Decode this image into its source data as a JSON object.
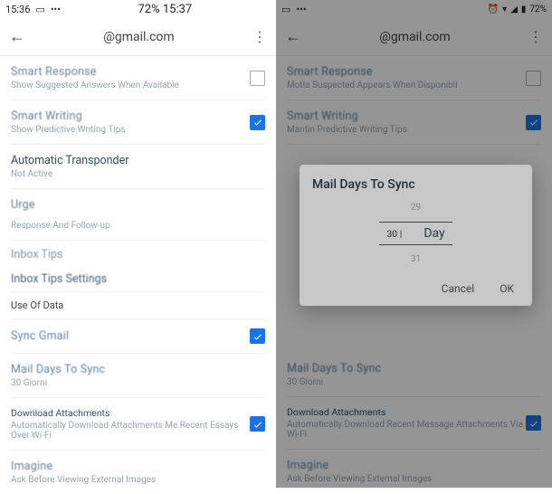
{
  "left": {
    "status": {
      "time": "15:36",
      "battery_text": "72% 15:37"
    },
    "header": {
      "title": "@gmail.com"
    },
    "smart_response": {
      "label": "Smart Response",
      "sub": "Show Suggested Answers When Available"
    },
    "smart_writing": {
      "label": "Smart Writing",
      "sub": "Show Predictive Writing Tips"
    },
    "autoresponder": {
      "label": "Automatic Transponder",
      "sub": "Not Active"
    },
    "urge": {
      "label": "Urge",
      "sub": "Response And Follow-up"
    },
    "inbox_tips_hdr": "Inbox Tips",
    "inbox_tips_link": "Inbox Tips Settings",
    "use_of_data": "Use Of Data",
    "sync_gmail": {
      "label": "Sync Gmail"
    },
    "days_sync": {
      "label": "Mail Days To Sync",
      "sub": "30 Giorni"
    },
    "dl_attach": {
      "label": "Download Attachments",
      "sub": "Automatically Download Attachments Me Recent Essays Over Wi-Fi"
    },
    "imagine": {
      "label": "Imagine",
      "sub": "Ask Before Viewing External Images"
    }
  },
  "right": {
    "status": {
      "battery_text": "72%"
    },
    "header": {
      "title": "@gmail.com"
    },
    "smart_response": {
      "label": "Smart Response",
      "sub": "Motla Suspected Appears When Disponibli"
    },
    "smart_writing": {
      "label": "Smart Writing",
      "sub": "Mantin Predictive Writing Tips"
    },
    "days_sync": {
      "label": "Mail Days To Sync",
      "sub": "30 Giorni"
    },
    "dl_attach": {
      "label": "Download Attachments",
      "sub": "Automatically Download Recent Message Attachments Via Wi-Fi"
    },
    "imagine": {
      "label": "Imagine",
      "sub": "Ask Before Viewing External Images"
    }
  },
  "dialog": {
    "title": "Mail Days To Sync",
    "opt_prev": "29",
    "opt_sel": "30 |",
    "opt_next": "31",
    "unit": "Day",
    "cancel": "Cancel",
    "ok": "OK"
  }
}
